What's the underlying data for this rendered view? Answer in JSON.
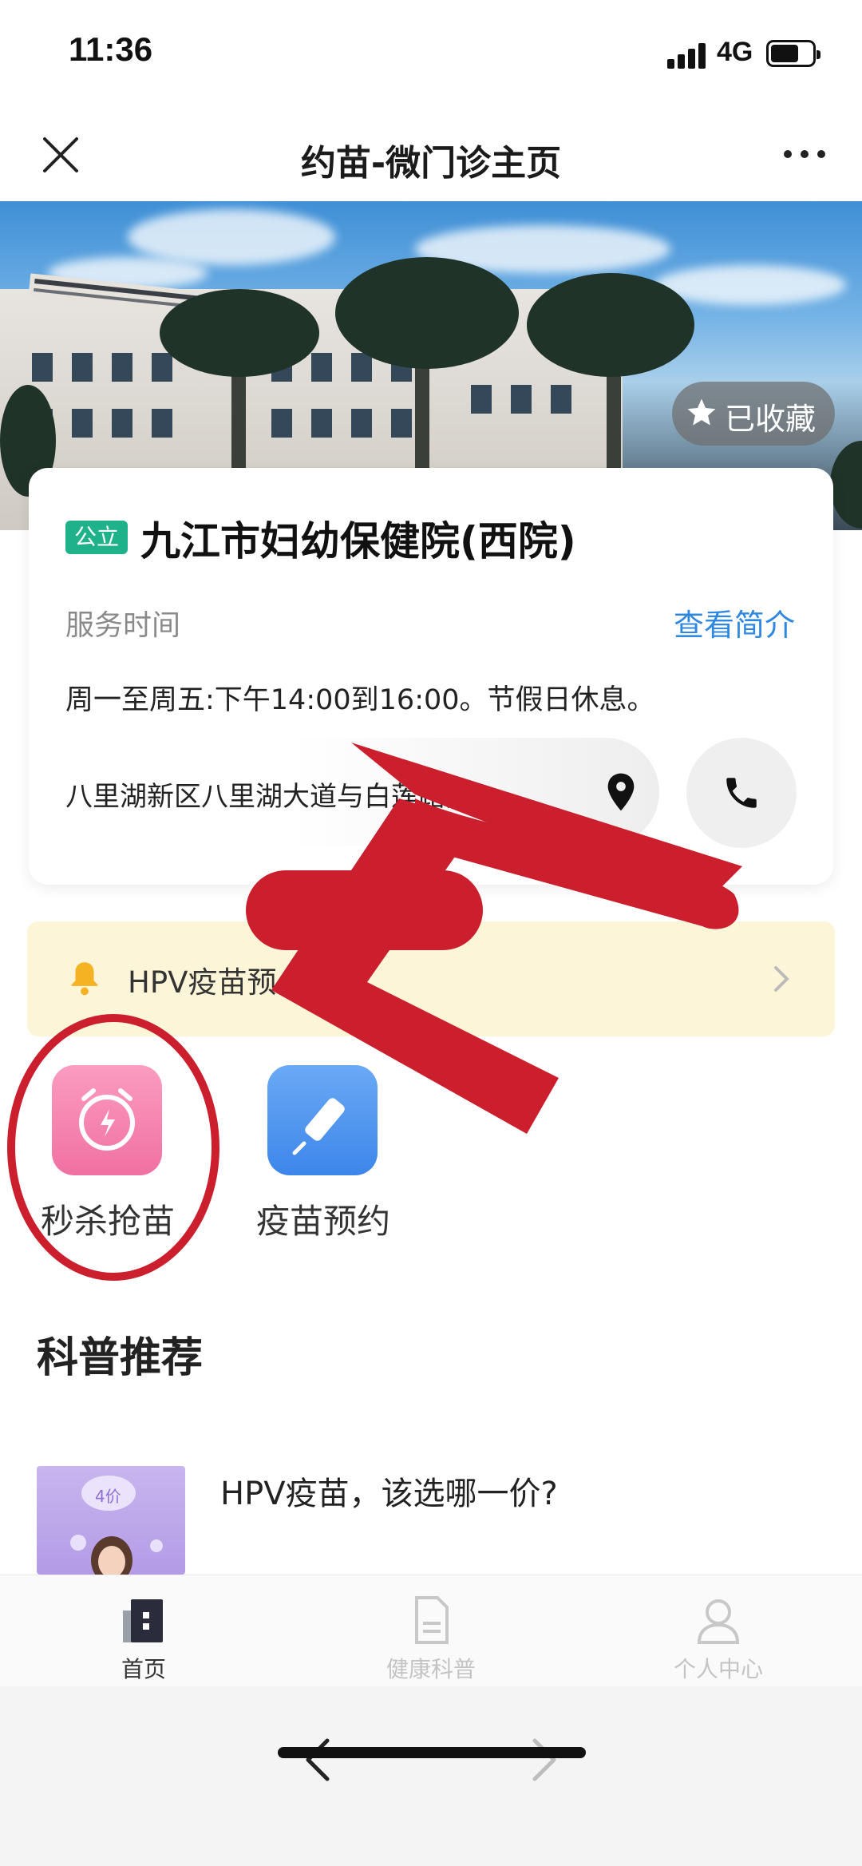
{
  "status_bar": {
    "time": "11:36",
    "network": "4G"
  },
  "nav": {
    "title": "约苗-微门诊主页"
  },
  "hero": {
    "favorite_label": "已收藏"
  },
  "hospital": {
    "tag": "公立",
    "name": "九江市妇幼保健院(西院)",
    "service_time_label": "服务时间",
    "intro_link": "查看简介",
    "service_hours": "周一至周五:下午14:00到16:00。节假日休息。",
    "address": "八里湖新区八里湖大道与白莲路交..."
  },
  "notice": {
    "text": "HPV疫苗预"
  },
  "actions": [
    {
      "label": "秒杀抢苗",
      "icon": "alarm-clock-icon",
      "color": "#f47ea7"
    },
    {
      "label": "疫苗预约",
      "icon": "syringe-icon",
      "color": "#4a90ee"
    }
  ],
  "section": {
    "title": "科普推荐"
  },
  "articles": [
    {
      "title": "HPV疫苗，该选哪一价?",
      "thumb_badge": "4价"
    }
  ],
  "tabbar": {
    "tabs": [
      {
        "label": "首页",
        "active": true
      },
      {
        "label": "健康科普",
        "active": false
      },
      {
        "label": "个人中心",
        "active": false
      }
    ]
  },
  "annotation": {
    "color": "#cc1f2d"
  }
}
